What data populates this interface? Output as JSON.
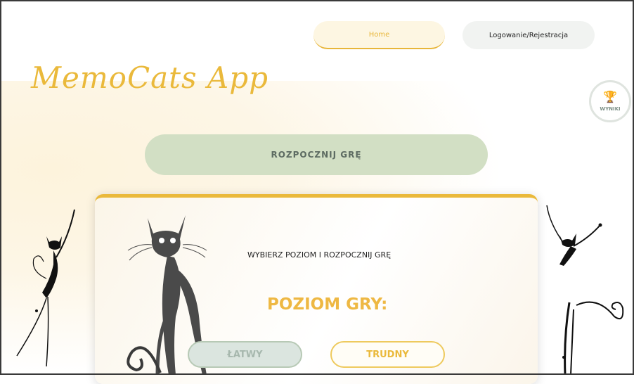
{
  "nav": {
    "home_label": "Home",
    "login_label": "Logowanie/Rejestracja"
  },
  "brand": {
    "logo_text": "MemoCats App"
  },
  "results": {
    "label": "WYNIKI",
    "icon": "trophy-icon"
  },
  "start": {
    "label": "ROZPOCZNIJ GRĘ"
  },
  "game_panel": {
    "instruction": "WYBIERZ POZIOM I ROZPOCZNIJ GRĘ",
    "level_title": "POZIOM GRY:",
    "levels": [
      {
        "label": "ŁATWY"
      },
      {
        "label": "TRUDNY"
      }
    ]
  },
  "colors": {
    "accent": "#eab93b",
    "start_button": "#d2dfc4",
    "easy_button": "#dbe5df"
  }
}
